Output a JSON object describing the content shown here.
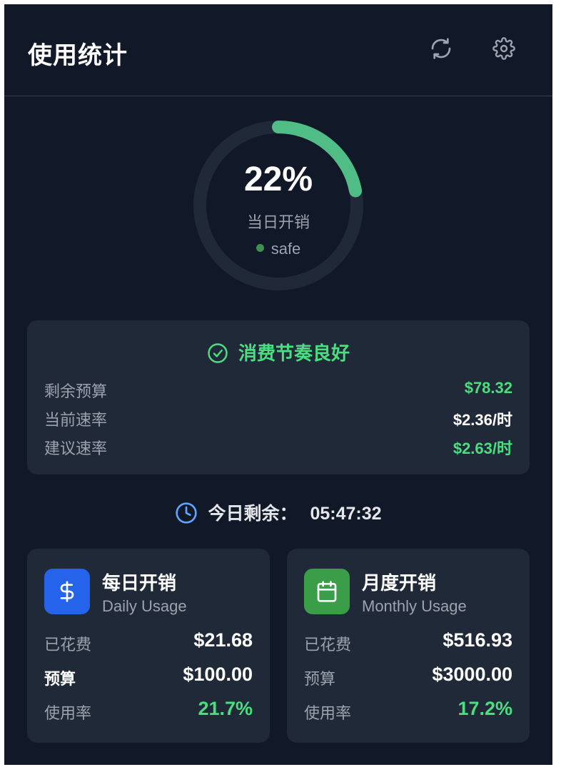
{
  "header": {
    "title": "使用统计",
    "refresh_icon": "refresh-icon",
    "settings_icon": "gear-icon"
  },
  "gauge": {
    "percent_text": "22%",
    "percent_value": 22,
    "label": "当日开销",
    "status": "safe",
    "color": "#4fbd85"
  },
  "status_card": {
    "headline": "消费节奏良好",
    "rows": [
      {
        "label": "剩余预算",
        "value": "$78.32",
        "color": "#4ade80"
      },
      {
        "label": "当前速率",
        "value": "$2.36/时",
        "color": "#ffffff"
      },
      {
        "label": "建议速率",
        "value": "$2.63/时",
        "color": "#4ade80"
      }
    ]
  },
  "countdown": {
    "label": "今日剩余：",
    "time": "05:47:32"
  },
  "daily": {
    "title": "每日开销",
    "subtitle": "Daily Usage",
    "icon": "dollar-icon",
    "spent_label": "已花费",
    "spent": "$21.68",
    "budget_label": "预算",
    "budget": "$100.00",
    "rate_label": "使用率",
    "rate": "21.7%"
  },
  "monthly": {
    "title": "月度开销",
    "subtitle": "Monthly Usage",
    "icon": "calendar-icon",
    "spent_label": "已花费",
    "spent": "$516.93",
    "budget_label": "预算",
    "budget": "$3000.00",
    "rate_label": "使用率",
    "rate": "17.2%"
  },
  "colors": {
    "background": "#111827",
    "card": "#1f2937",
    "accent_green": "#4ade80",
    "dollar_badge": "#2563eb",
    "calendar_badge": "#3a9d48"
  }
}
